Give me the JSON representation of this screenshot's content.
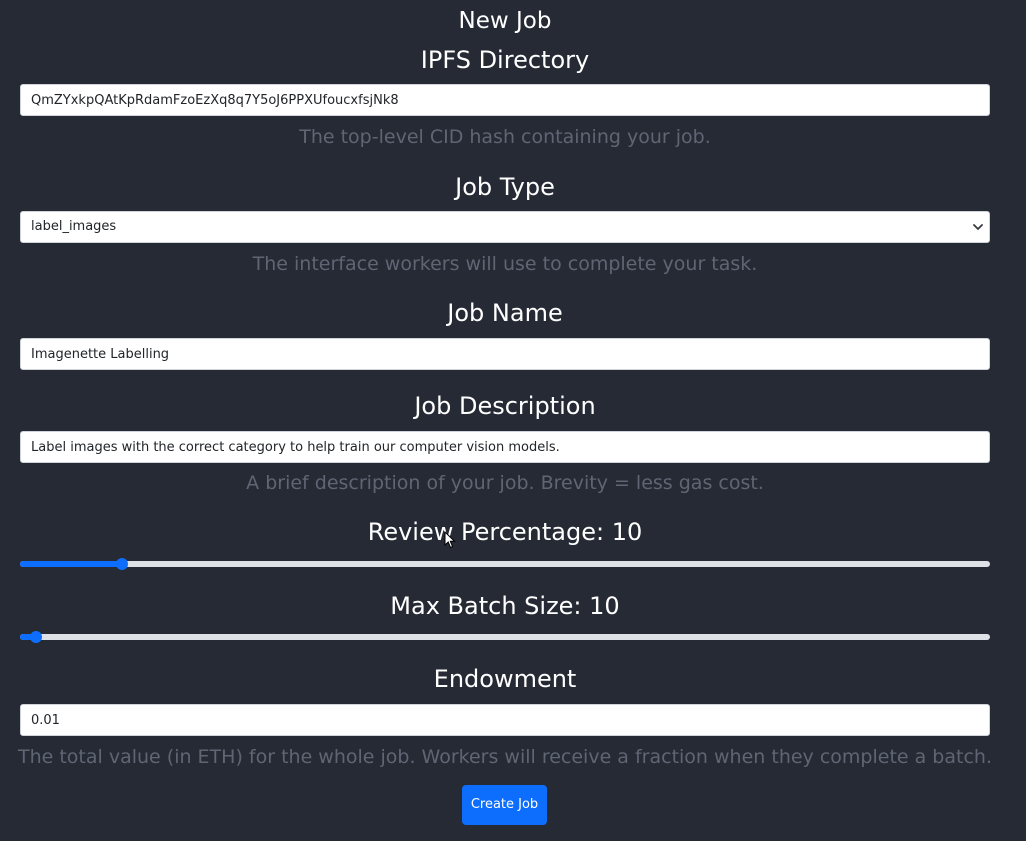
{
  "page": {
    "title": "New Job"
  },
  "ipfs": {
    "label": "IPFS Directory",
    "value": "QmZYxkpQAtKpRdamFzoEzXq8q7Y5oJ6PPXUfoucxfsjNk8",
    "help": "The top-level CID hash containing your job."
  },
  "job_type": {
    "label": "Job Type",
    "selected": "label_images",
    "help": "The interface workers will use to complete your task."
  },
  "job_name": {
    "label": "Job Name",
    "value": "Imagenette Labelling"
  },
  "job_description": {
    "label": "Job Description",
    "value": "Label images with the correct category to help train our computer vision models.",
    "help": "A brief description of your job. Brevity = less gas cost."
  },
  "review_percentage": {
    "label": "Review Percentage: 10",
    "value": 10,
    "fraction": 0.105
  },
  "max_batch_size": {
    "label": "Max Batch Size: 10",
    "value": 10,
    "fraction": 0.016
  },
  "endowment": {
    "label": "Endowment",
    "value": "0.01",
    "help": "The total value (in ETH) for the whole job. Workers will receive a fraction when they complete a batch."
  },
  "actions": {
    "create_label": "Create Job"
  },
  "colors": {
    "background": "#262a35",
    "accent": "#0d6efd",
    "help_text": "#5f6573",
    "track": "#dee2e6"
  }
}
